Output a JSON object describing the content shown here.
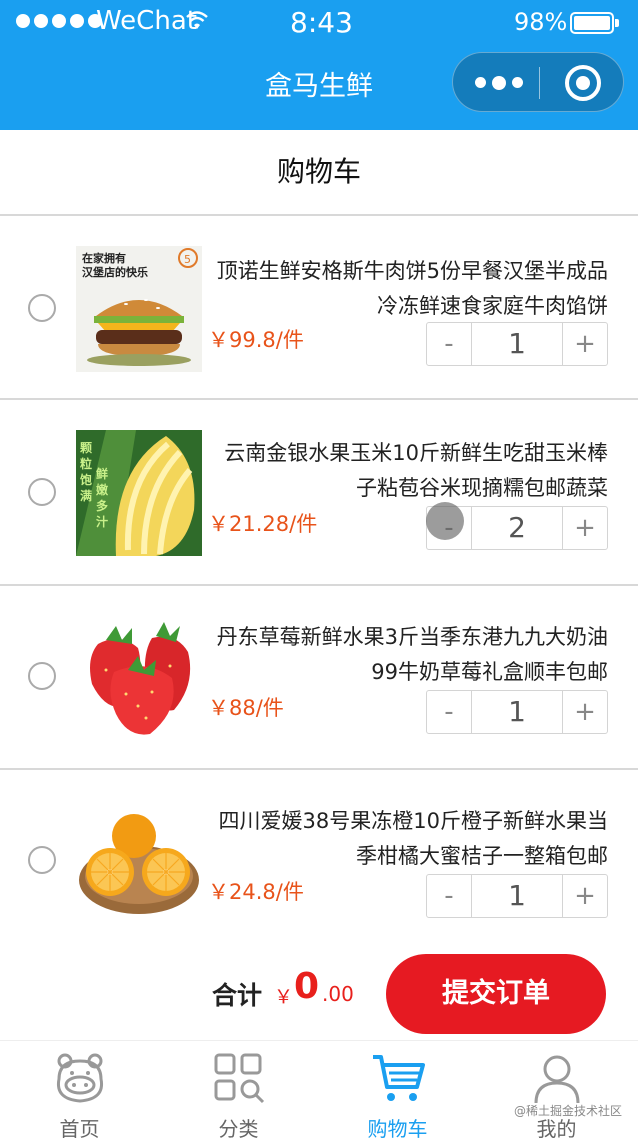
{
  "status_bar": {
    "carrier": "WeChat",
    "time": "8:43",
    "battery": "98%"
  },
  "nav": {
    "title": "盒马生鲜"
  },
  "page": {
    "title": "购物车"
  },
  "colors": {
    "accent": "#1a9ff0",
    "price": "#e8531a",
    "submit": "#e61a22"
  },
  "items": [
    {
      "name": "顶诺生鲜安格斯牛肉饼5份早餐汉堡半成品冷冻鲜速食家庭牛肉馅饼",
      "price": "￥99.8/件",
      "quantity": "1",
      "image_text": [
        "在家拥有",
        "汉堡店的快乐"
      ]
    },
    {
      "name": "云南金银水果玉米10斤新鲜生吃甜玉米棒子粘苞谷米现摘糯包邮蔬菜",
      "price": "￥21.28/件",
      "quantity": "2",
      "image_text": [
        "颗粒饱满",
        "鲜嫩多汁"
      ]
    },
    {
      "name": "丹东草莓新鲜水果3斤当季东港九九大奶油99牛奶草莓礼盒顺丰包邮",
      "price": "￥88/件",
      "quantity": "1"
    },
    {
      "name": "四川爱媛38号果冻橙10斤橙子新鲜水果当季柑橘大蜜桔子一整箱包邮",
      "price": "￥24.8/件",
      "quantity": "1"
    }
  ],
  "stepper": {
    "minus": "-",
    "plus": "+"
  },
  "footer": {
    "total_label": "合计",
    "currency": "￥",
    "total_int": "0",
    "total_dec": ".00",
    "submit": "提交订单"
  },
  "tabs": [
    {
      "label": "首页",
      "icon": "hippo-icon"
    },
    {
      "label": "分类",
      "icon": "category-icon"
    },
    {
      "label": "购物车",
      "icon": "cart-icon",
      "active": true
    },
    {
      "label": "我的",
      "icon": "user-icon"
    }
  ],
  "watermark": "@稀土掘金技术社区"
}
